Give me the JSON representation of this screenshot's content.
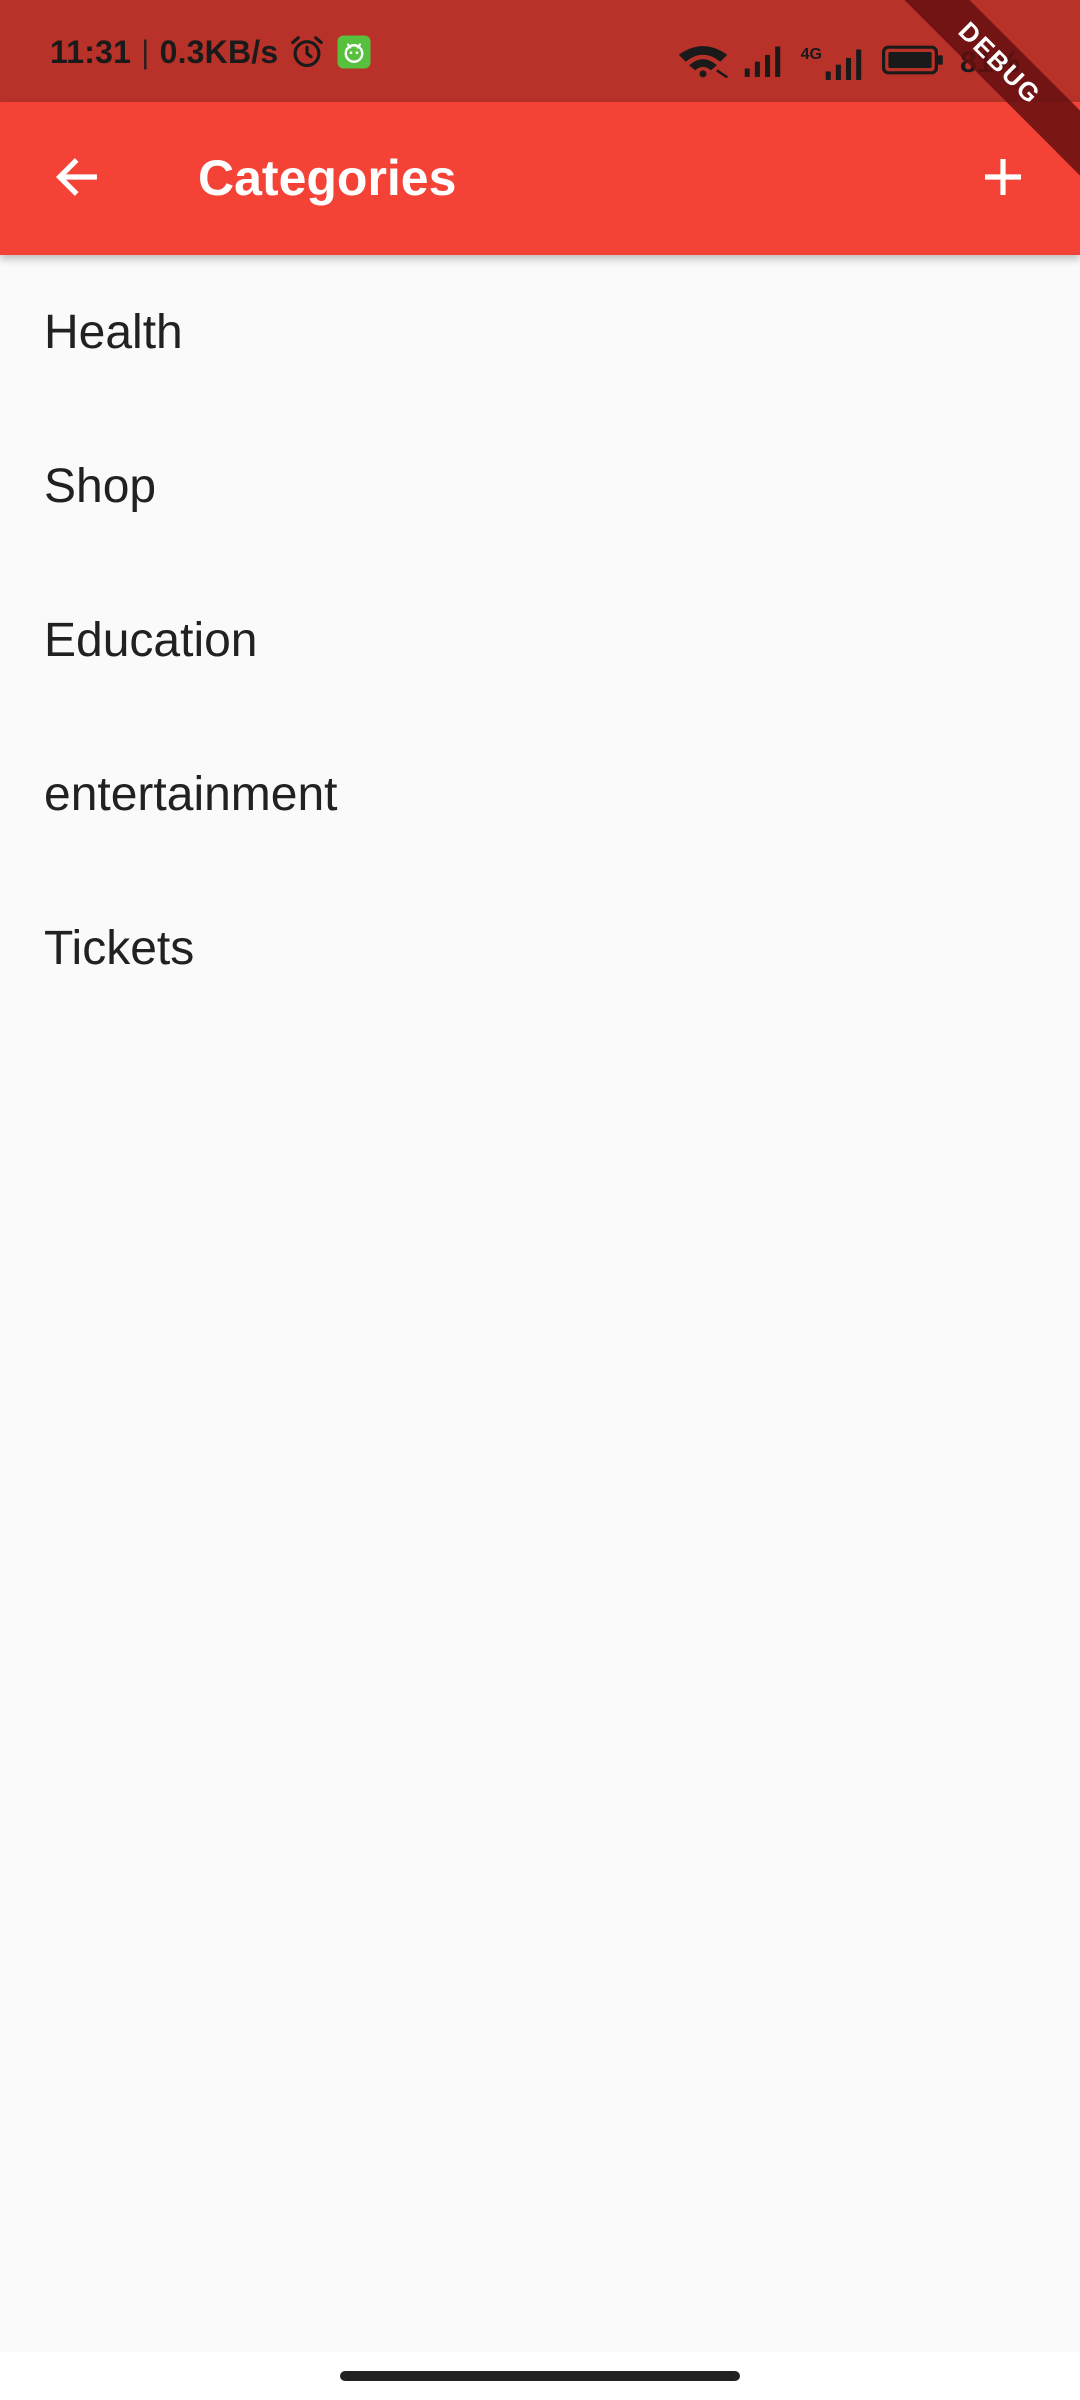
{
  "status_bar": {
    "time": "11:31",
    "separator": "|",
    "network_speed": "0.3KB/s",
    "battery_percent": "81%",
    "network_type": "4G",
    "icons": [
      "alarm-icon",
      "app-notification-icon",
      "wifi-icon",
      "signal-icon",
      "signal-4g-icon",
      "battery-icon"
    ],
    "colors": {
      "background": "#b9322a"
    }
  },
  "debug_banner": {
    "label": "DEBUG"
  },
  "app_bar": {
    "title": "Categories",
    "back_icon": "arrow-back-icon",
    "add_icon": "plus-icon",
    "colors": {
      "background": "#f44336",
      "foreground": "#ffffff"
    }
  },
  "categories": [
    {
      "label": "Health"
    },
    {
      "label": "Shop"
    },
    {
      "label": "Education"
    },
    {
      "label": "entertainment"
    },
    {
      "label": "Tickets"
    }
  ]
}
